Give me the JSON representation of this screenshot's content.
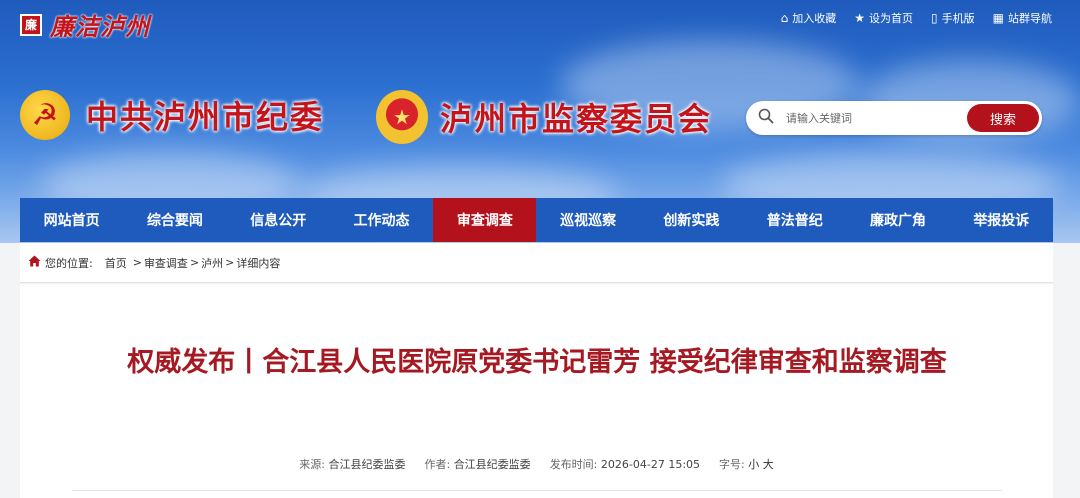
{
  "site": {
    "brand": "廉洁泸州",
    "brand_seal": "廉",
    "top_links": [
      {
        "icon": "home-icon",
        "glyph": "⌂",
        "label": "加入收藏"
      },
      {
        "icon": "star-icon",
        "glyph": "★",
        "label": "设为首页"
      },
      {
        "icon": "phone-icon",
        "glyph": "▯",
        "label": "手机版"
      },
      {
        "icon": "grid-icon",
        "glyph": "▦",
        "label": "站群导航"
      }
    ],
    "org_left": "中共泸州市纪委",
    "org_right": "泸州市监察委员会"
  },
  "search": {
    "placeholder": "请输入关键词",
    "button": "搜索"
  },
  "nav": {
    "items": [
      "网站首页",
      "综合要闻",
      "信息公开",
      "工作动态",
      "审查调查",
      "巡视巡察",
      "创新实践",
      "普法普纪",
      "廉政广角",
      "举报投诉"
    ],
    "active_index": 4
  },
  "breadcrumb": {
    "prefix": "您的位置:",
    "items": [
      "首页",
      "审查调查",
      "泸州",
      "详细内容"
    ],
    "separator": ">"
  },
  "article": {
    "title": "权威发布丨合江县人民医院原党委书记雷芳 接受纪律审查和监察调查",
    "source_label": "来源:",
    "source": "合江县纪委监委",
    "author_label": "作者:",
    "author": "合江县纪委监委",
    "time_label": "发布时间:",
    "time": "2026-04-27 15:05",
    "fontsize_label": "字号:",
    "fontsize_small": "小",
    "fontsize_large": "大"
  },
  "colors": {
    "primary_blue": "#1f5bbd",
    "accent_red": "#b3111c",
    "title_red": "#a51a22"
  }
}
